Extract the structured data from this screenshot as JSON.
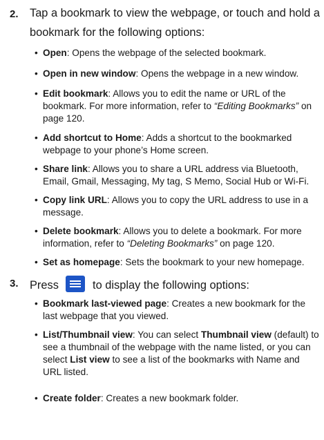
{
  "step2": {
    "number": "2.",
    "line1": "Tap a bookmark to view the webpage, or touch and hold a",
    "line2": "bookmark for the following options:"
  },
  "bullets2": [
    {
      "term": "Open",
      "desc": ": Opens the webpage of the selected bookmark."
    },
    {
      "term": "Open in new window",
      "desc": ": Opens the webpage in a new window."
    },
    {
      "term": "Edit bookmark",
      "desc": ": Allows you to edit the name or URL of the bookmark. For more information, refer to ",
      "ref": "“Editing Bookmarks”",
      "tail": " on page 120."
    },
    {
      "term": "Add shortcut to Home",
      "desc": ": Adds a shortcut to the bookmarked webpage to your phone’s Home screen."
    },
    {
      "term": "Share link",
      "desc": ": Allows you to share a URL address via Bluetooth, Email, Gmail, Messaging, My tag, S Memo, Social Hub or Wi-Fi."
    },
    {
      "term": "Copy link URL",
      "desc": ": Allows you to copy the URL address to use in a message."
    },
    {
      "term": "Delete bookmark",
      "desc": ": Allows you to delete a bookmark. For more information, refer to ",
      "ref": "“Deleting Bookmarks”",
      "tail": "  on page 120."
    },
    {
      "term": "Set as homepage",
      "desc": ": Sets the bookmark to your new homepage."
    }
  ],
  "step3": {
    "number": "3.",
    "before": "Press",
    "after": "to display the following options:",
    "icon": "menu-key-icon",
    "icon_color": "#1d55c6"
  },
  "bullets3": [
    {
      "term": "Bookmark last-viewed page",
      "desc": ": Creates a new bookmark for the last webpage that you viewed."
    },
    {
      "term": "List/Thumbnail view",
      "desc": ": You can select ",
      "term2": "Thumbnail view",
      "desc2": " (default) to see a thumbnail of the webpage with the name listed, or you can select ",
      "term3": "List view",
      "desc3": " to see a list of the bookmarks with Name and URL listed."
    },
    {
      "term": "Create folder",
      "desc": ": Creates a new bookmark folder."
    }
  ]
}
